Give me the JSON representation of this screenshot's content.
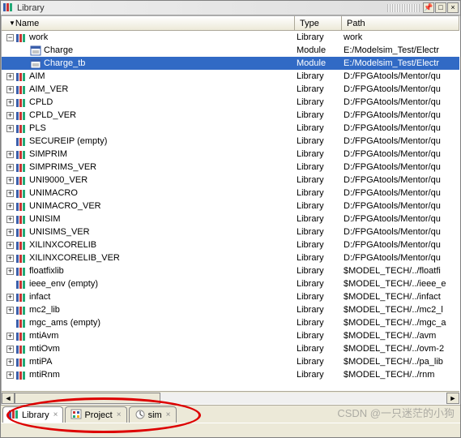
{
  "window": {
    "title": "Library",
    "btn_min": "−",
    "btn_max": "□",
    "btn_pin": "📌",
    "btn_close": "×"
  },
  "columns": {
    "name": "Name",
    "type": "Type",
    "path": "Path"
  },
  "tree": [
    {
      "depth": 0,
      "exp": "minus",
      "icon": "lib",
      "label": "work",
      "type": "Library",
      "path": "work",
      "sel": false
    },
    {
      "depth": 1,
      "exp": "none",
      "icon": "mod",
      "label": "Charge",
      "type": "Module",
      "path": "E:/Modelsim_Test/Electr",
      "sel": false
    },
    {
      "depth": 1,
      "exp": "none",
      "icon": "mod",
      "label": "Charge_tb",
      "type": "Module",
      "path": "E:/Modelsim_Test/Electr",
      "sel": true
    },
    {
      "depth": 0,
      "exp": "plus",
      "icon": "lib",
      "label": "AIM",
      "type": "Library",
      "path": "D:/FPGAtools/Mentor/qu",
      "sel": false
    },
    {
      "depth": 0,
      "exp": "plus",
      "icon": "lib",
      "label": "AIM_VER",
      "type": "Library",
      "path": "D:/FPGAtools/Mentor/qu",
      "sel": false
    },
    {
      "depth": 0,
      "exp": "plus",
      "icon": "lib",
      "label": "CPLD",
      "type": "Library",
      "path": "D:/FPGAtools/Mentor/qu",
      "sel": false
    },
    {
      "depth": 0,
      "exp": "plus",
      "icon": "lib",
      "label": "CPLD_VER",
      "type": "Library",
      "path": "D:/FPGAtools/Mentor/qu",
      "sel": false
    },
    {
      "depth": 0,
      "exp": "plus",
      "icon": "lib",
      "label": "PLS",
      "type": "Library",
      "path": "D:/FPGAtools/Mentor/qu",
      "sel": false
    },
    {
      "depth": 0,
      "exp": "none",
      "icon": "lib",
      "label": "SECUREIP  (empty)",
      "type": "Library",
      "path": "D:/FPGAtools/Mentor/qu",
      "sel": false
    },
    {
      "depth": 0,
      "exp": "plus",
      "icon": "lib",
      "label": "SIMPRIM",
      "type": "Library",
      "path": "D:/FPGAtools/Mentor/qu",
      "sel": false
    },
    {
      "depth": 0,
      "exp": "plus",
      "icon": "lib",
      "label": "SIMPRIMS_VER",
      "type": "Library",
      "path": "D:/FPGAtools/Mentor/qu",
      "sel": false
    },
    {
      "depth": 0,
      "exp": "plus",
      "icon": "lib",
      "label": "UNI9000_VER",
      "type": "Library",
      "path": "D:/FPGAtools/Mentor/qu",
      "sel": false
    },
    {
      "depth": 0,
      "exp": "plus",
      "icon": "lib",
      "label": "UNIMACRO",
      "type": "Library",
      "path": "D:/FPGAtools/Mentor/qu",
      "sel": false
    },
    {
      "depth": 0,
      "exp": "plus",
      "icon": "lib",
      "label": "UNIMACRO_VER",
      "type": "Library",
      "path": "D:/FPGAtools/Mentor/qu",
      "sel": false
    },
    {
      "depth": 0,
      "exp": "plus",
      "icon": "lib",
      "label": "UNISIM",
      "type": "Library",
      "path": "D:/FPGAtools/Mentor/qu",
      "sel": false
    },
    {
      "depth": 0,
      "exp": "plus",
      "icon": "lib",
      "label": "UNISIMS_VER",
      "type": "Library",
      "path": "D:/FPGAtools/Mentor/qu",
      "sel": false
    },
    {
      "depth": 0,
      "exp": "plus",
      "icon": "lib",
      "label": "XILINXCORELIB",
      "type": "Library",
      "path": "D:/FPGAtools/Mentor/qu",
      "sel": false
    },
    {
      "depth": 0,
      "exp": "plus",
      "icon": "lib",
      "label": "XILINXCORELIB_VER",
      "type": "Library",
      "path": "D:/FPGAtools/Mentor/qu",
      "sel": false
    },
    {
      "depth": 0,
      "exp": "plus",
      "icon": "lib",
      "label": "floatfixlib",
      "type": "Library",
      "path": "$MODEL_TECH/../floatfi",
      "sel": false
    },
    {
      "depth": 0,
      "exp": "none",
      "icon": "lib",
      "label": "ieee_env  (empty)",
      "type": "Library",
      "path": "$MODEL_TECH/../ieee_e",
      "sel": false
    },
    {
      "depth": 0,
      "exp": "plus",
      "icon": "lib",
      "label": "infact",
      "type": "Library",
      "path": "$MODEL_TECH/../infact",
      "sel": false
    },
    {
      "depth": 0,
      "exp": "plus",
      "icon": "lib",
      "label": "mc2_lib",
      "type": "Library",
      "path": "$MODEL_TECH/../mc2_l",
      "sel": false
    },
    {
      "depth": 0,
      "exp": "none",
      "icon": "lib",
      "label": "mgc_ams  (empty)",
      "type": "Library",
      "path": "$MODEL_TECH/../mgc_a",
      "sel": false
    },
    {
      "depth": 0,
      "exp": "plus",
      "icon": "lib",
      "label": "mtiAvm",
      "type": "Library",
      "path": "$MODEL_TECH/../avm",
      "sel": false
    },
    {
      "depth": 0,
      "exp": "plus",
      "icon": "lib",
      "label": "mtiOvm",
      "type": "Library",
      "path": "$MODEL_TECH/../ovm-2",
      "sel": false
    },
    {
      "depth": 0,
      "exp": "plus",
      "icon": "lib",
      "label": "mtiPA",
      "type": "Library",
      "path": "$MODEL_TECH/../pa_lib",
      "sel": false
    },
    {
      "depth": 0,
      "exp": "plus",
      "icon": "lib",
      "label": "mtiRnm",
      "type": "Library",
      "path": "$MODEL_TECH/../rnm",
      "sel": false
    }
  ],
  "tabs": [
    {
      "id": "library",
      "label": "Library",
      "icon": "lib",
      "active": true
    },
    {
      "id": "project",
      "label": "Project",
      "icon": "proj",
      "active": false
    },
    {
      "id": "sim",
      "label": "sim",
      "icon": "sim",
      "active": false
    }
  ],
  "watermark": "CSDN @一只迷茫的小狗"
}
